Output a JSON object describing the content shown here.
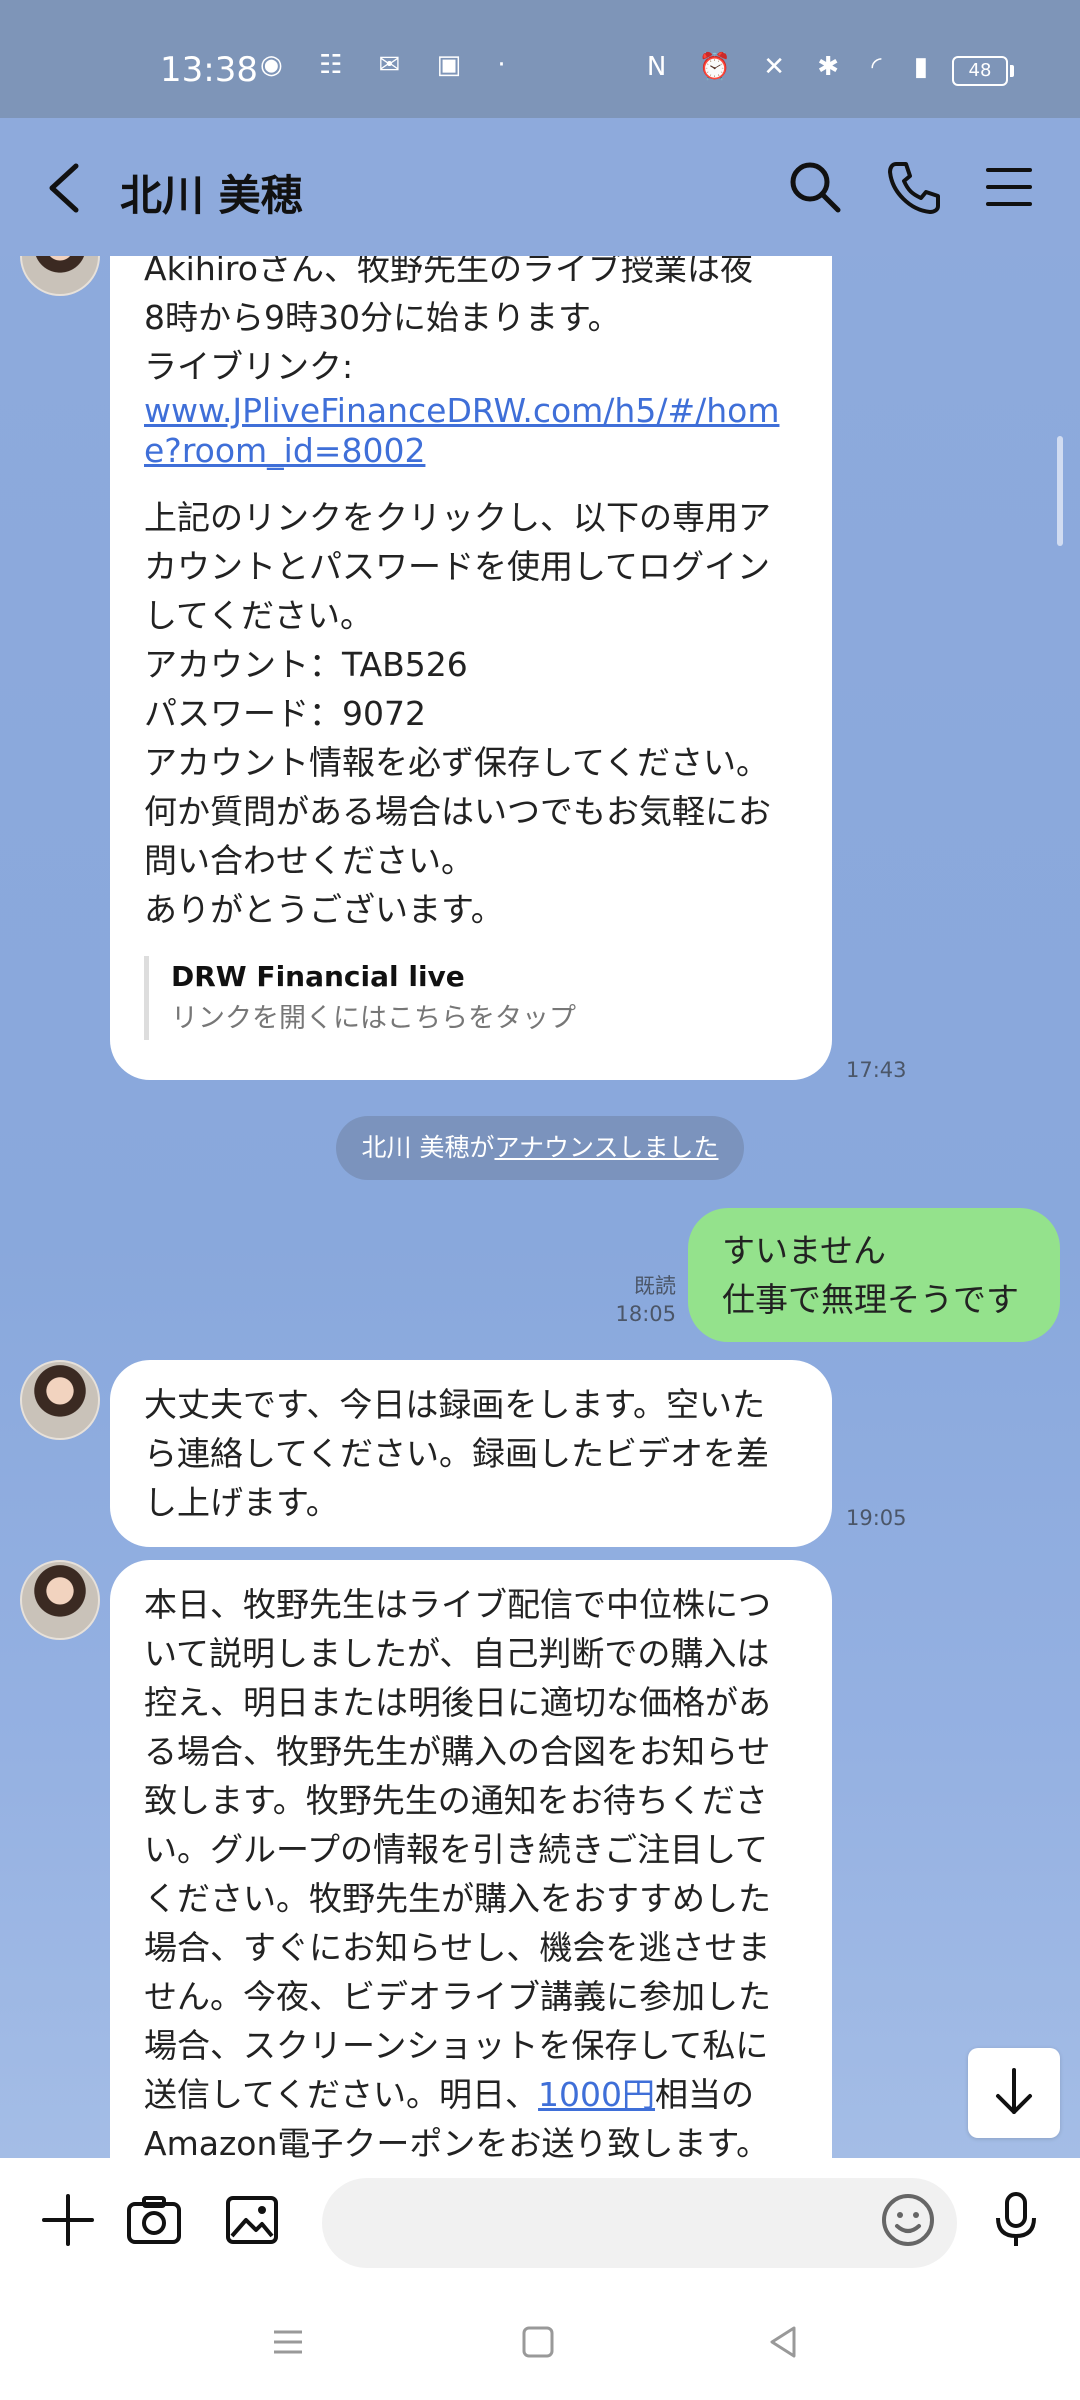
{
  "status_bar": {
    "time": "13:38",
    "left_icons": "◉ ☷ ✉ ▣ ·",
    "right_icons": "N ⏰ ✕ ✱ ◜ ▮",
    "battery": "48"
  },
  "header": {
    "title": "北川 美穂"
  },
  "messages": {
    "m1": {
      "partial_line": "Akihiroさん、牧野先生のライブ授業は夜",
      "line2": "8時から9時30分に始まります。",
      "line3": "ライブリンク:",
      "link": "www.JPliveFinanceDRW.com/h5/#/home?room_id=8002",
      "body": "上記のリンクをクリックし、以下の専用アカウントとパスワードを使用してログインしてください。",
      "account": "アカウント：TAB526",
      "password": "パスワード：9072",
      "body2": "アカウント情報を必ず保存してください。何か質問がある場合はいつでもお気軽にお問い合わせください。",
      "thanks": "ありがとうございます。",
      "preview_title": "DRW Financial live",
      "preview_sub": "リンクを開くにはこちらをタップ",
      "time": "17:43"
    },
    "announce_name": "北川 美穂が",
    "announce_link": "アナウンスしました",
    "m2": {
      "line1": "すいません",
      "line2": "仕事で無理そうです",
      "read": "既読",
      "time": "18:05"
    },
    "m3": {
      "text": "大丈夫です、今日は録画をします。空いたら連絡してください。録画したビデオを差し上げます。",
      "time": "19:05"
    },
    "m4": {
      "text_a": "本日、牧野先生はライブ配信で中位株について説明しましたが、自己判断での購入は控え、明日または明後日に適切な価格がある場合、牧野先生が購入の合図をお知らせ致します。牧野先生の通知をお待ちください。グループの情報を引き続きご注目してください。牧野先生が購入をおすすめした場合、すぐにお知らせし、機会を逃させません。今夜、ビデオライブ講義に参加した場合、スクリーンショットを保存して私に送信してください。明日、",
      "link": "1000円",
      "text_b": "相当のAmazon電子クーポンをお送り致します。"
    }
  },
  "input": {
    "placeholder": ""
  }
}
